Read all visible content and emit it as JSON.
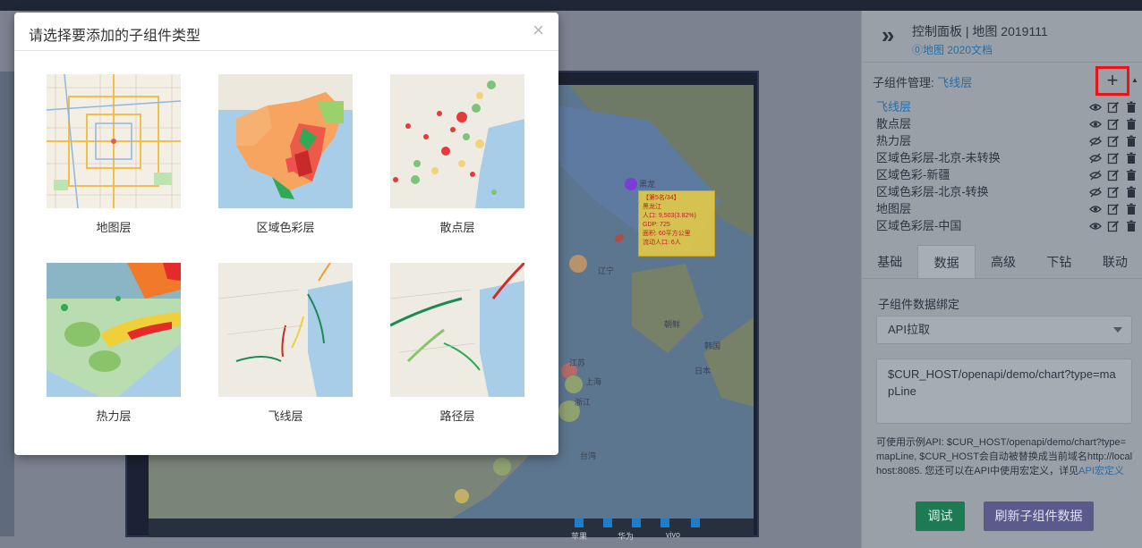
{
  "editor": {
    "panel_title": "控制面板 | 地图 2019111",
    "doc_link": "⓪地图 2020文档",
    "sub_manager_label": "子组件管理:",
    "sub_manager_active": "飞线层",
    "add_symbol": "+",
    "layers": [
      {
        "name": "飞线层",
        "active": true,
        "visible": true
      },
      {
        "name": "散点层",
        "active": false,
        "visible": true
      },
      {
        "name": "热力层",
        "active": false,
        "visible": false
      },
      {
        "name": "区域色彩层-北京-未转换",
        "active": false,
        "visible": false
      },
      {
        "name": "区域色彩-新疆",
        "active": false,
        "visible": false
      },
      {
        "name": "区域色彩层-北京-转换",
        "active": false,
        "visible": false
      },
      {
        "name": "地图层",
        "active": false,
        "visible": true
      },
      {
        "name": "区域色彩层-中国",
        "active": false,
        "visible": true
      }
    ],
    "tabs": [
      "基础",
      "数据",
      "高级",
      "下钻",
      "联动"
    ],
    "active_tab": "数据",
    "binding_label": "子组件数据绑定",
    "api_select_value": "API拉取",
    "api_url": "$CUR_HOST/openapi/demo/chart?type=mapLine",
    "help_text": "可使用示例API: $CUR_HOST/openapi/demo/chart?type=mapLine, $CUR_HOST会自动被替换成当前域名http://localhost:8085. 您还可以在API中使用宏定义，详见",
    "help_link": "API宏定义",
    "debug_button": "调试",
    "refresh_button": "刷新子组件数据"
  },
  "map_preview": {
    "tooltip_lines": [
      "【第5名/34】",
      "黑龙江",
      "人口: 9,503(3.82%)",
      "GDP: 725",
      "面积: 60平方公里",
      "流动人口: 6人"
    ],
    "bar_labels": [
      "苹果",
      "华为",
      "vivo"
    ],
    "place_labels": {
      "heilongjiang": "黑龙",
      "liaoning": "辽宁",
      "jiangsu": "江苏",
      "shanghai": "上海",
      "zhejiang": "浙江",
      "taiwan": "台湾",
      "korea_n": "朝鲜",
      "korea_s": "韩国",
      "japan": "日本"
    }
  },
  "modal": {
    "title": "请选择要添加的子组件类型",
    "close_symbol": "×",
    "options": [
      {
        "label": "地图层",
        "key": "map"
      },
      {
        "label": "区域色彩层",
        "key": "region"
      },
      {
        "label": "散点层",
        "key": "scatter"
      },
      {
        "label": "热力层",
        "key": "heat"
      },
      {
        "label": "飞线层",
        "key": "flyline"
      },
      {
        "label": "路径层",
        "key": "path"
      }
    ]
  },
  "colors": {
    "accent_link": "#2a6da3",
    "debug_green": "#1c7b53",
    "refresh_purple": "#5a5a8c",
    "highlight_red": "#e8151b"
  }
}
